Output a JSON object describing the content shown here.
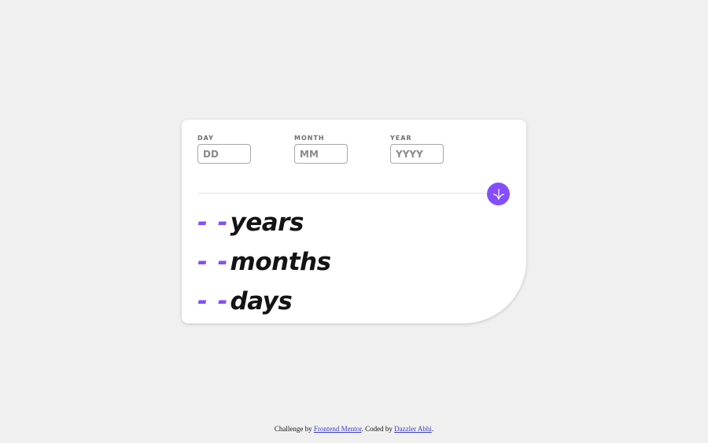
{
  "theme": {
    "accent": "#854dff",
    "background": "#f0f0f0",
    "card": "#ffffff",
    "text": "#141414"
  },
  "form": {
    "day": {
      "label": "DAY",
      "placeholder": "DD",
      "value": ""
    },
    "month": {
      "label": "MONTH",
      "placeholder": "MM",
      "value": ""
    },
    "year": {
      "label": "YEAR",
      "placeholder": "YYYY",
      "value": ""
    },
    "submit_icon": "arrow-down-icon"
  },
  "results": {
    "years": {
      "value": "- -",
      "unit": "years"
    },
    "months": {
      "value": "- -",
      "unit": "months"
    },
    "days": {
      "value": "- -",
      "unit": "days"
    }
  },
  "attribution": {
    "prefix": "Challenge by ",
    "link1": "Frontend Mentor",
    "middle": ". Coded by ",
    "link2": "Dazzler Abhi",
    "suffix": "."
  }
}
